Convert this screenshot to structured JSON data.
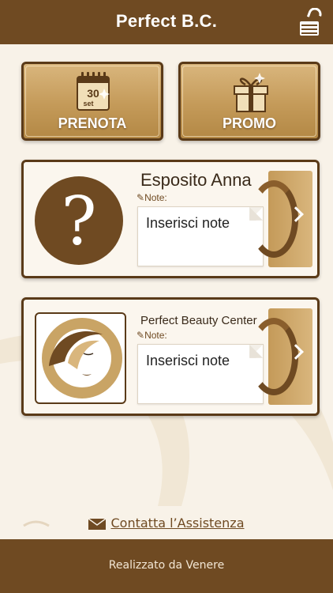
{
  "header": {
    "title": "Perfect B.C.",
    "lock_icon": "unlock-icon"
  },
  "tiles": [
    {
      "label": "PRENOTA",
      "icon": "calendar-icon",
      "calendar_day": "30",
      "calendar_month": "set"
    },
    {
      "label": "PROMO",
      "icon": "gift-icon"
    }
  ],
  "cards": [
    {
      "name": "Esposito Anna",
      "avatar_icon": "question-mark-icon",
      "note_label": "Note:",
      "note_placeholder": "Inserisci note"
    },
    {
      "name": "Perfect Beauty Center",
      "avatar_icon": "beauty-logo-icon",
      "note_label": "Note:",
      "note_placeholder": "Inserisci note"
    }
  ],
  "contact": {
    "label": "Contatta l’Assistenza",
    "icon": "mail-icon"
  },
  "footer": {
    "text": "Realizzato da Venere"
  },
  "colors": {
    "brand_brown": "#6f4a22",
    "gold": "#c49a59",
    "background": "#f8f2e8"
  }
}
